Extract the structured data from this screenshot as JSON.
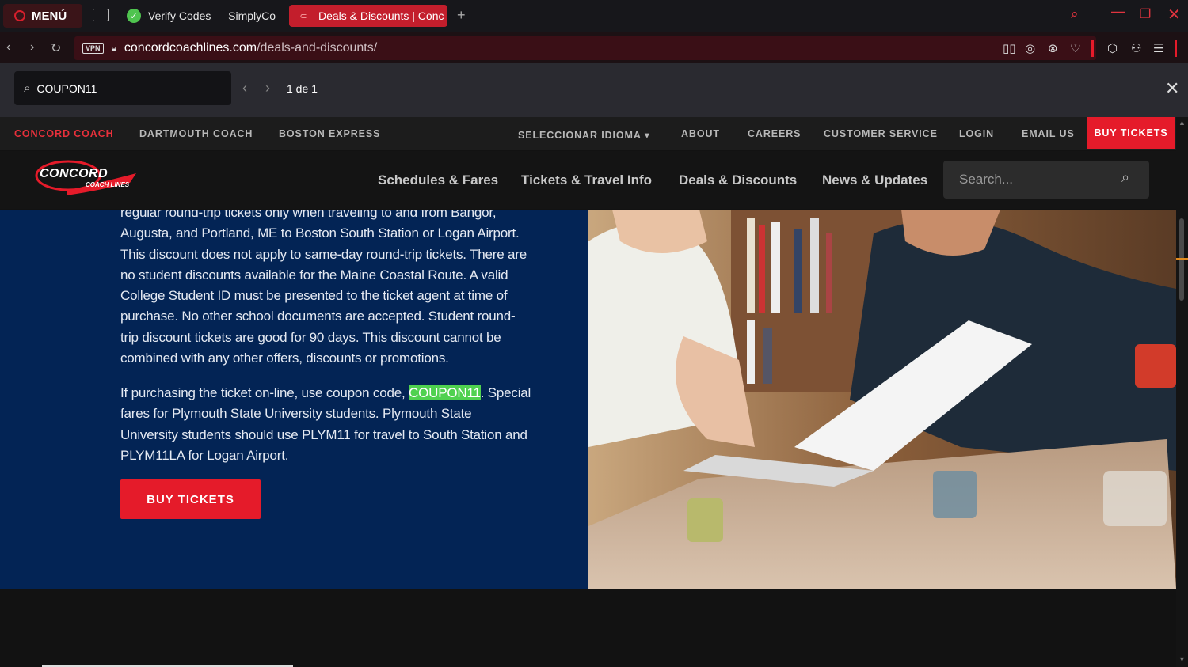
{
  "browser": {
    "menu_label": "MENÚ",
    "tabs": [
      {
        "label": "Verify Codes — SimplyCo",
        "active": false
      },
      {
        "label": "Deals & Discounts | Conc",
        "active": true
      }
    ],
    "new_tab": "+",
    "address": {
      "vpn": "VPN",
      "domain": "concordcoachlines.com",
      "path": "/deals-and-discounts/"
    }
  },
  "find_bar": {
    "query": "COUPON11",
    "count": "1 de 1"
  },
  "site": {
    "top_nav": {
      "brands": [
        "CONCORD COACH",
        "DARTMOUTH COACH",
        "BOSTON EXPRESS"
      ],
      "language": "SELECCIONAR IDIOMA ▾",
      "links": [
        "ABOUT",
        "CAREERS",
        "CUSTOMER SERVICE",
        "LOGIN",
        "EMAIL US"
      ],
      "buy": "BUY TICKETS"
    },
    "logo": {
      "line1": "CONCORD",
      "line2": "COACH LINES"
    },
    "main_nav": [
      "Schedules & Fares",
      "Tickets & Travel Info",
      "Deals & Discounts",
      "News & Updates"
    ],
    "search_placeholder": "Search..."
  },
  "content": {
    "para1": "regular round-trip tickets only when traveling to and from Bangor, Augusta, and Portland, ME to Boston South Station or Logan Airport. This discount does not apply to same-day round-trip tickets. There are no student discounts available for the Maine Coastal Route. A valid College Student ID must be presented to the ticket agent at time of purchase. No other school documents are accepted. Student round-trip discount tickets are good for 90 days. This discount cannot be combined with any other offers, discounts or promotions.",
    "para2_before": "If purchasing the ticket on-line, use coupon code, ",
    "para2_code": "COUPON11",
    "para2_after": ". Special fares for Plymouth State University students. Plymouth State University students should use PLYM11 for travel to South Station and PLYM11LA for Logan Airport.",
    "buy_button": "BUY TICKETS"
  },
  "colors": {
    "accent_red": "#e51b2a",
    "content_blue": "#032455",
    "highlight_green": "#4fd14f"
  }
}
